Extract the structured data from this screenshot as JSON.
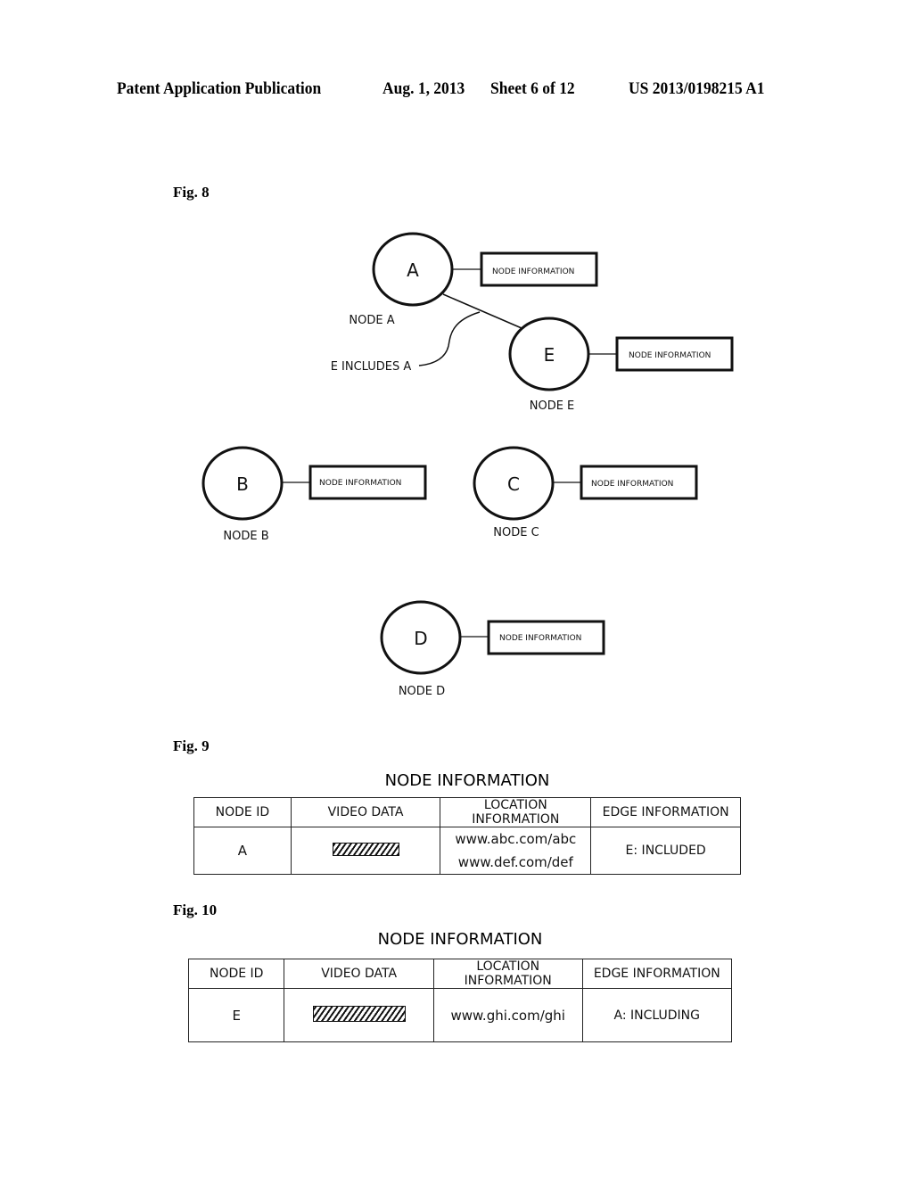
{
  "header": {
    "publication": "Patent Application Publication",
    "date": "Aug. 1, 2013",
    "sheet": "Sheet 6 of 12",
    "number": "US 2013/0198215 A1"
  },
  "fig8": {
    "label": "Fig. 8",
    "nodes": [
      {
        "id": "A",
        "caption": "NODE A",
        "info": "NODE INFORMATION"
      },
      {
        "id": "E",
        "caption": "NODE E",
        "info": "NODE INFORMATION"
      },
      {
        "id": "B",
        "caption": "NODE B",
        "info": "NODE INFORMATION"
      },
      {
        "id": "C",
        "caption": "NODE C",
        "info": "NODE INFORMATION"
      },
      {
        "id": "D",
        "caption": "NODE D",
        "info": "NODE INFORMATION"
      }
    ],
    "edge_label": "E INCLUDES A"
  },
  "fig9": {
    "label": "Fig. 9",
    "title": "NODE INFORMATION",
    "columns": [
      "NODE ID",
      "VIDEO DATA",
      "LOCATION INFORMATION",
      "EDGE INFORMATION"
    ],
    "row": {
      "node_id": "A",
      "locations": [
        "www.abc.com/abc",
        "www.def.com/def"
      ],
      "edge": "E:  INCLUDED"
    }
  },
  "fig10": {
    "label": "Fig. 10",
    "title": "NODE INFORMATION",
    "columns": [
      "NODE ID",
      "VIDEO DATA",
      "LOCATION INFORMATION",
      "EDGE INFORMATION"
    ],
    "row": {
      "node_id": "E",
      "locations": [
        "www.ghi.com/ghi"
      ],
      "edge": "A:  INCLUDING"
    }
  }
}
